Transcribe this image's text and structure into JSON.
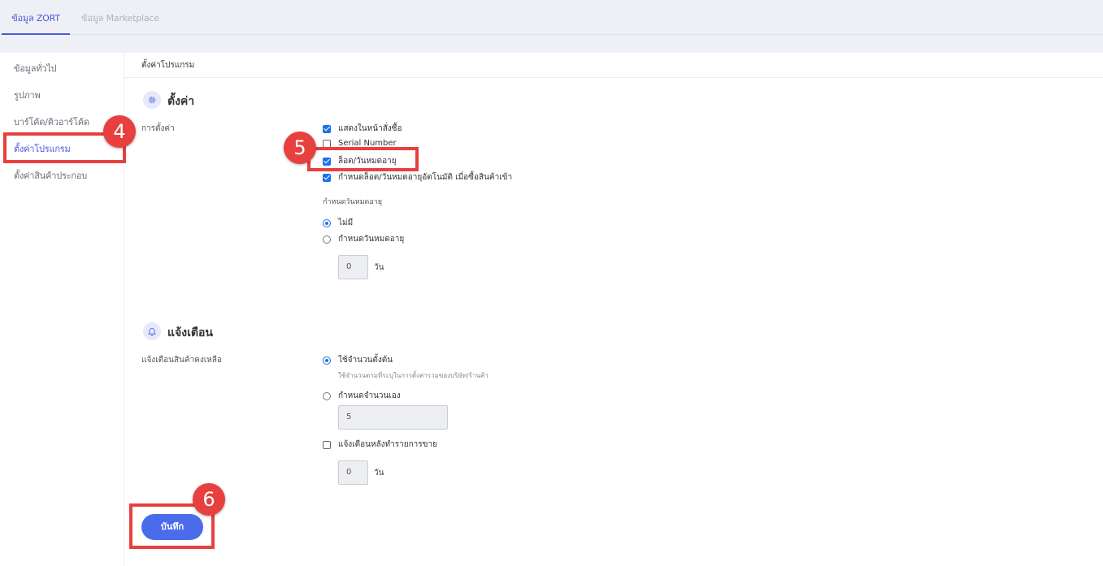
{
  "tabs": [
    {
      "label": "ข้อมูล ZORT",
      "active": true
    },
    {
      "label": "ข้อมูล Marketplace",
      "active": false
    }
  ],
  "sidebar": {
    "items": [
      {
        "label": "ข้อมูลทั่วไป",
        "active": false
      },
      {
        "label": "รูปภาพ",
        "active": false
      },
      {
        "label": "บาร์โค้ด/คิวอาร์โค้ด",
        "active": false
      },
      {
        "label": "ตั้งค่าโปรแกรม",
        "active": true
      },
      {
        "label": "ตั้งค่าสินค้าประกอบ",
        "active": false
      }
    ]
  },
  "main": {
    "title": "ตั้งค่าโปรแกรม",
    "settings": {
      "title": "ตั้งค่า",
      "icon": "gear-icon",
      "row_label": "การตั้งค่า",
      "checkboxes": [
        {
          "label": "แสดงในหน้าสั่งซื้อ",
          "checked": true
        },
        {
          "label": "Serial Number",
          "checked": false
        },
        {
          "label": "ล็อต/วันหมดอายุ",
          "checked": true
        },
        {
          "label": "กำหนดล็อต/วันหมดอายุอัตโนมัติ เมื่อซื้อสินค้าเข้า",
          "checked": true
        }
      ],
      "expiry_label": "กำหนดวันหมดอายุ",
      "expiry_options": [
        {
          "label": "ไม่มี",
          "selected": true
        },
        {
          "label": "กำหนดวันหมดอายุ",
          "selected": false
        }
      ],
      "expiry_days_value": "0",
      "expiry_days_unit": "วัน"
    },
    "notify": {
      "title": "แจ้งเตือน",
      "icon": "bell-icon",
      "row_label": "แจ้งเตือนสินค้าคงเหลือ",
      "option_default": {
        "label": "ใช้จำนวนตั้งต้น",
        "selected": true,
        "hint": "ใช้จำนวนตามที่ระบุในการตั้งค่ารวมของบริษัท/ร้านค้า"
      },
      "option_custom": {
        "label": "กำหนดจำนวนเอง",
        "selected": false,
        "value": "5"
      },
      "after_sale": {
        "label": "แจ้งเตือนหลังทำรายการขาย",
        "checked": false,
        "value": "0",
        "unit": "วัน"
      }
    },
    "save_label": "บันทึก"
  },
  "annotations": [
    {
      "number": "4",
      "color": "#e8403f"
    },
    {
      "number": "5",
      "color": "#e8403f"
    },
    {
      "number": "6",
      "color": "#e8403f"
    }
  ]
}
